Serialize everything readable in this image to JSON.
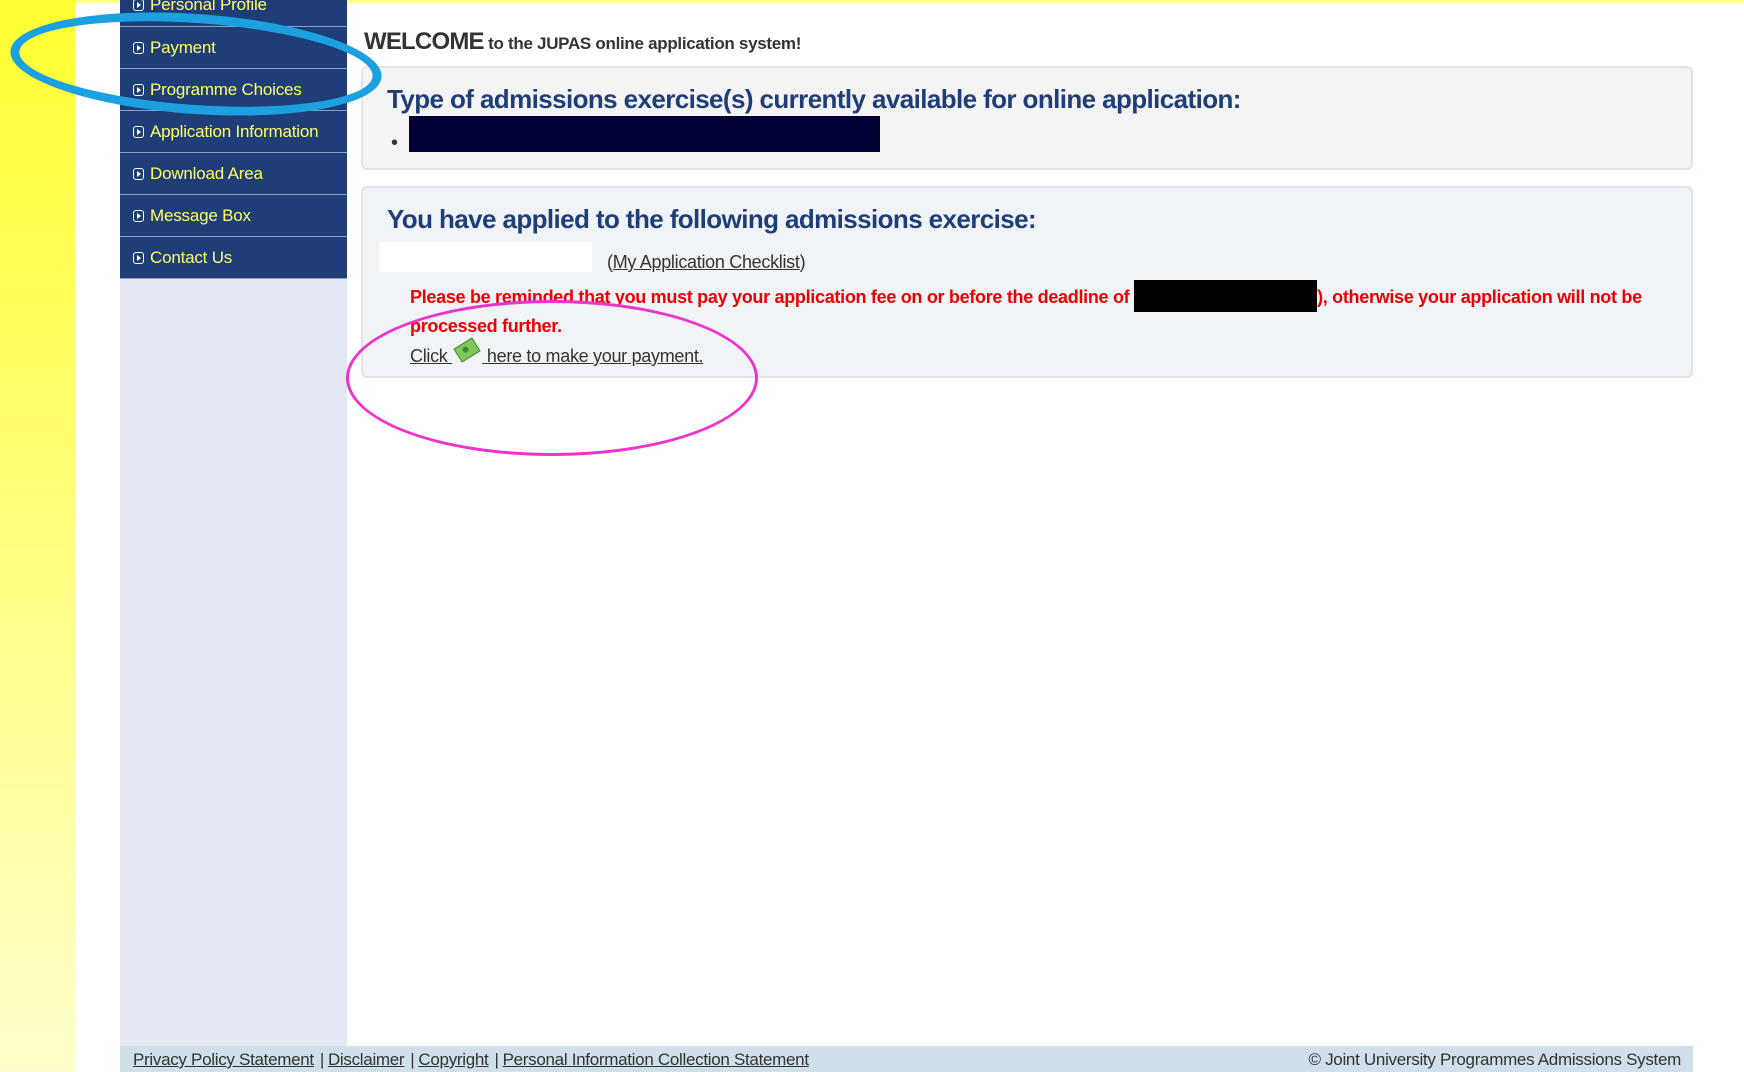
{
  "sidebar": {
    "items": [
      {
        "label": "Personal Profile"
      },
      {
        "label": "Payment"
      },
      {
        "label": "Programme Choices"
      },
      {
        "label": "Application Information"
      },
      {
        "label": "Download Area"
      },
      {
        "label": "Message Box"
      },
      {
        "label": "Contact Us"
      }
    ]
  },
  "welcome": {
    "big": "WELCOME",
    "rest": " to the JUPAS online application system!"
  },
  "available": {
    "heading": "Type of admissions exercise(s) currently available for online application:",
    "bullet": "•"
  },
  "applied": {
    "heading": "You have applied to the following admissions exercise:",
    "checklist_open": "(",
    "checklist_label": "My Application Checklist",
    "checklist_close": ")",
    "reminder_before": "Please be reminded that you must pay your application fee on or before the deadline of ",
    "reminder_after": "), otherwise your application will not be processed further.",
    "pay_click": "Click ",
    "pay_rest": " here to make your payment."
  },
  "footer": {
    "links": [
      {
        "label": "Privacy Policy Statement"
      },
      {
        "label": "Disclaimer"
      },
      {
        "label": "Copyright"
      },
      {
        "label": "Personal Information Collection Statement"
      }
    ],
    "separator": "|",
    "copyright": "© Joint University Programmes Admissions System"
  },
  "icons": {
    "nav_bullet": "nav-bullet-icon",
    "payment": "money-icon"
  },
  "colors": {
    "nav_bg": "#1f3d77",
    "nav_text": "#ffff66",
    "reminder": "#ee0000",
    "annotation_blue": "#1ca0e0",
    "annotation_pink": "#ee33cc"
  }
}
